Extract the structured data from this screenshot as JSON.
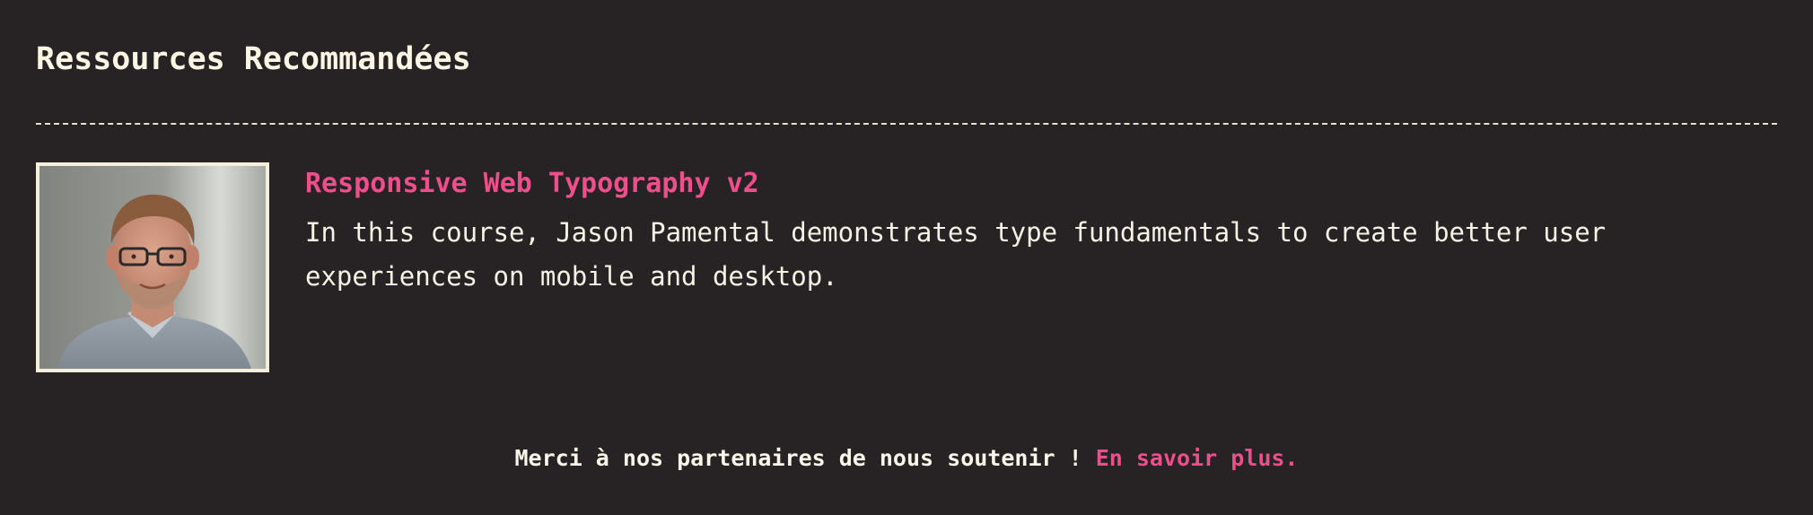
{
  "section": {
    "title": "Ressources Recommandées"
  },
  "resource": {
    "title": "Responsive Web Typography v2",
    "description": "In this course, Jason Pamental demonstrates type fundamentals to create better user experiences on mobile and desktop.",
    "image_label": "instructor-photo"
  },
  "footer": {
    "text": "Merci à nos partenaires de nous soutenir !",
    "link_label": "En savoir plus."
  },
  "colors": {
    "background": "#272325",
    "accent": "#ec4f8a",
    "text": "#f6f1e4"
  }
}
